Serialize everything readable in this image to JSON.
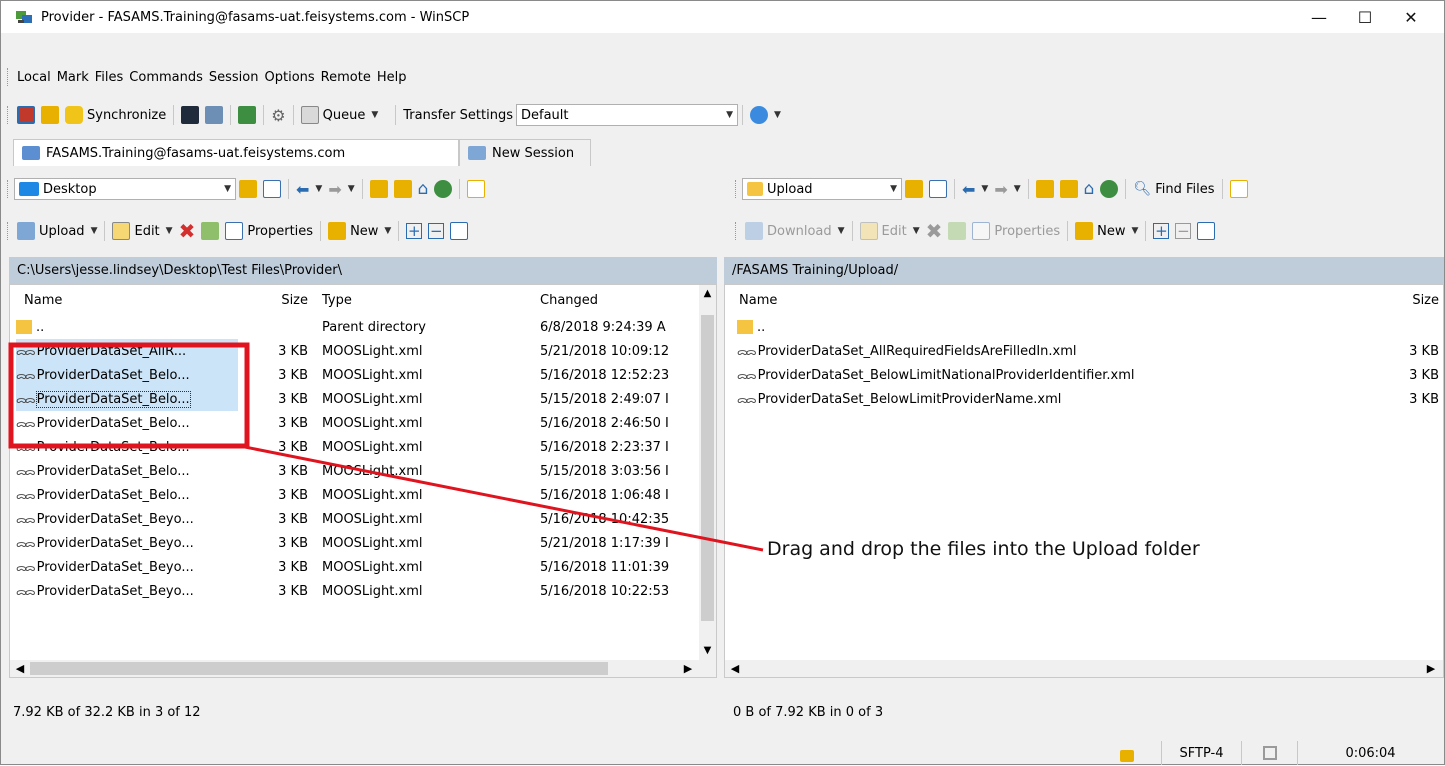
{
  "window": {
    "title": "Provider - FASAMS.Training@fasams-uat.feisystems.com - WinSCP",
    "minimize": "—",
    "maximize": "☐",
    "close": "✕"
  },
  "menu": [
    "Local",
    "Mark",
    "Files",
    "Commands",
    "Session",
    "Options",
    "Remote",
    "Help"
  ],
  "toolbar": {
    "synchronize": "Synchronize",
    "queue": "Queue",
    "transfer_label": "Transfer Settings",
    "transfer_value": "Default"
  },
  "tabs": {
    "session": "FASAMS.Training@fasams-uat.feisystems.com",
    "new_session": "New Session"
  },
  "local": {
    "location": "Desktop",
    "upload": "Upload",
    "edit": "Edit",
    "properties": "Properties",
    "new": "New",
    "path": "C:\\Users\\jesse.lindsey\\Desktop\\Test Files\\Provider\\",
    "columns": {
      "name": "Name",
      "size": "Size",
      "type": "Type",
      "changed": "Changed"
    },
    "rows": [
      {
        "name": "..",
        "size": "",
        "type": "Parent directory",
        "changed": "6/8/2018  9:24:39 A"
      },
      {
        "name": "ProviderDataSet_AllR...",
        "size": "3 KB",
        "type": "MOOSLight.xml",
        "changed": "5/21/2018  10:09:12"
      },
      {
        "name": "ProviderDataSet_Belo...",
        "size": "3 KB",
        "type": "MOOSLight.xml",
        "changed": "5/16/2018  12:52:23"
      },
      {
        "name": "ProviderDataSet_Belo...",
        "size": "3 KB",
        "type": "MOOSLight.xml",
        "changed": "5/15/2018  2:49:07 I"
      },
      {
        "name": "ProviderDataSet_Belo...",
        "size": "3 KB",
        "type": "MOOSLight.xml",
        "changed": "5/16/2018  2:46:50 I"
      },
      {
        "name": "ProviderDataSet_Belo...",
        "size": "3 KB",
        "type": "MOOSLight.xml",
        "changed": "5/16/2018  2:23:37 I"
      },
      {
        "name": "ProviderDataSet_Belo...",
        "size": "3 KB",
        "type": "MOOSLight.xml",
        "changed": "5/15/2018  3:03:56 I"
      },
      {
        "name": "ProviderDataSet_Belo...",
        "size": "3 KB",
        "type": "MOOSLight.xml",
        "changed": "5/16/2018  1:06:48 I"
      },
      {
        "name": "ProviderDataSet_Beyo...",
        "size": "3 KB",
        "type": "MOOSLight.xml",
        "changed": "5/16/2018  10:42:35"
      },
      {
        "name": "ProviderDataSet_Beyo...",
        "size": "3 KB",
        "type": "MOOSLight.xml",
        "changed": "5/21/2018  1:17:39 I"
      },
      {
        "name": "ProviderDataSet_Beyo...",
        "size": "3 KB",
        "type": "MOOSLight.xml",
        "changed": "5/16/2018  11:01:39"
      },
      {
        "name": "ProviderDataSet_Beyo...",
        "size": "3 KB",
        "type": "MOOSLight.xml",
        "changed": "5/16/2018  10:22:53"
      }
    ],
    "status": "7.92 KB of 32.2 KB in 3 of 12"
  },
  "remote": {
    "location": "Upload",
    "find_files": "Find Files",
    "download": "Download",
    "edit": "Edit",
    "properties": "Properties",
    "new": "New",
    "path": "/FASAMS Training/Upload/",
    "columns": {
      "name": "Name",
      "size": "Size"
    },
    "rows": [
      {
        "name": "..",
        "size": ""
      },
      {
        "name": "ProviderDataSet_AllRequiredFieldsAreFilledIn.xml",
        "size": "3 KB"
      },
      {
        "name": "ProviderDataSet_BelowLimitNationalProviderIdentifier.xml",
        "size": "3 KB"
      },
      {
        "name": "ProviderDataSet_BelowLimitProviderName.xml",
        "size": "3 KB"
      }
    ],
    "status": "0 B of 7.92 KB in 0 of 3"
  },
  "statusbar": {
    "protocol": "SFTP-4",
    "elapsed": "0:06:04"
  },
  "annotation": {
    "text": "Drag and drop the files into the Upload folder",
    "color": "#e0141e"
  }
}
